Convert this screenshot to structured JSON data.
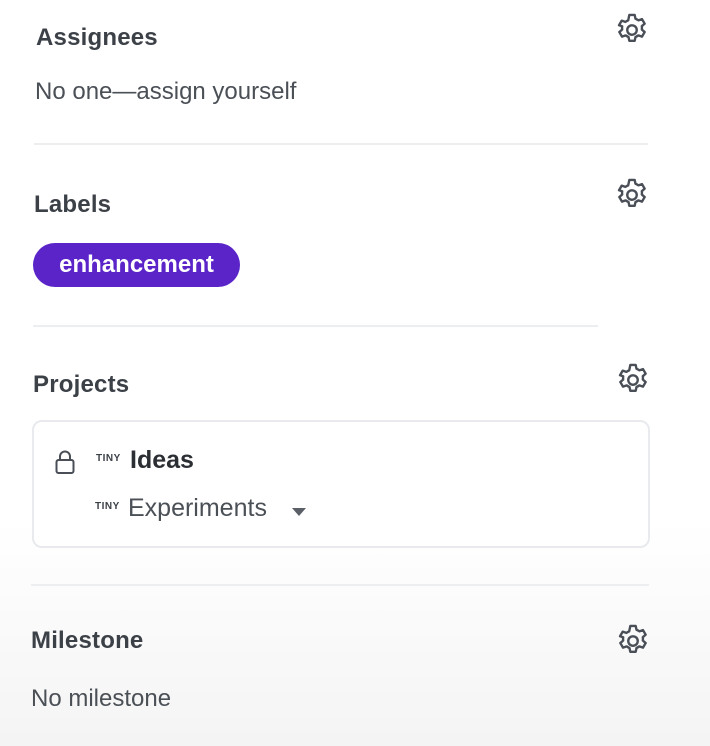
{
  "assignees": {
    "heading": "Assignees",
    "value": "No one—assign yourself",
    "settings_icon": "gear-icon"
  },
  "labels": {
    "heading": "Labels",
    "items": [
      {
        "name": "enhancement",
        "color": "#5a24c9"
      }
    ],
    "settings_icon": "gear-icon"
  },
  "projects": {
    "heading": "Projects",
    "settings_icon": "gear-icon",
    "card": {
      "lock_icon": "lock-icon",
      "project_tag": "TINY",
      "project_name": "Ideas",
      "column_tag": "TINY",
      "column_name": "Experiments",
      "caret_icon": "caret-down-icon"
    }
  },
  "milestone": {
    "heading": "Milestone",
    "value": "No milestone",
    "settings_icon": "gear-icon"
  }
}
